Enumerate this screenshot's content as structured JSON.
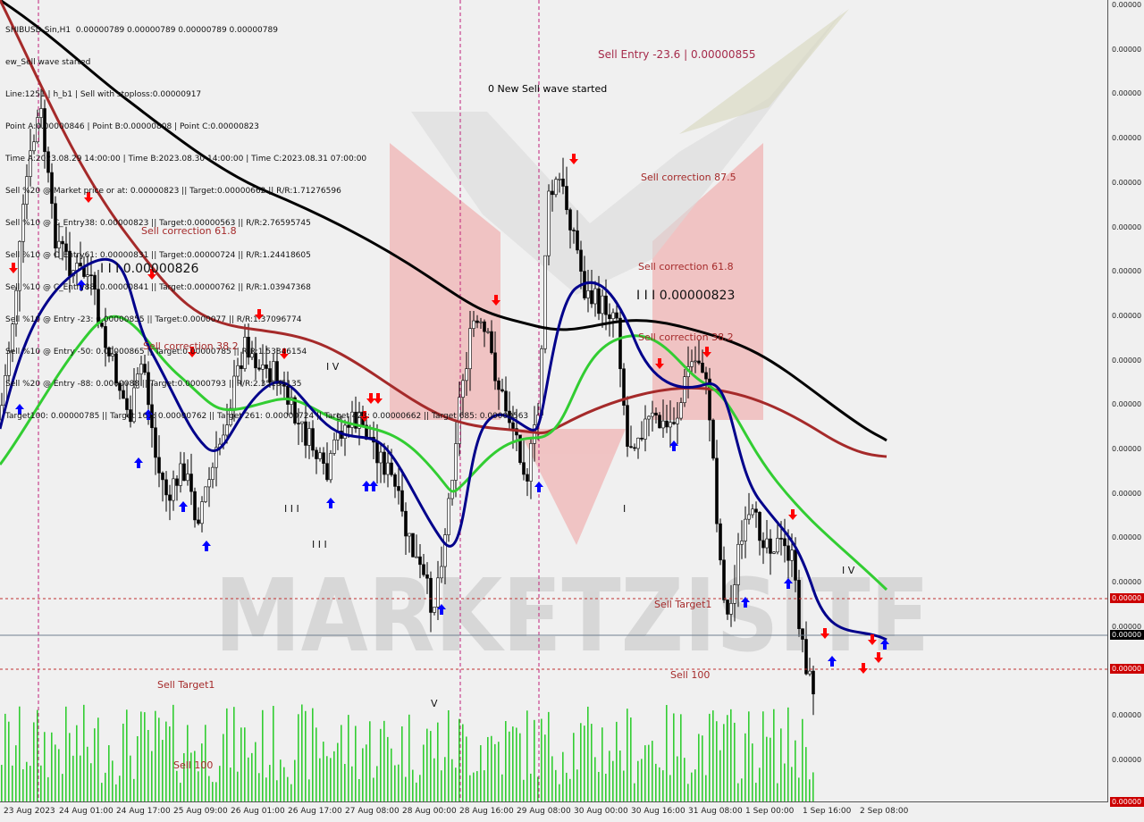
{
  "header": {
    "symbol_line": "SHIBUSD-Sin,H1  0.00000789 0.00000789 0.00000789 0.00000789",
    "lines": [
      "ew_Sell wave started",
      "Line:1251 | h_b1 | Sell with stoploss:0.00000917",
      "Point A:0.00000846 | Point B:0.00000808 | Point C:0.00000823",
      "Time A:2023.08.29 14:00:00 | Time B:2023.08.30 14:00:00 | Time C:2023.08.31 07:00:00",
      "Sell %20 @ Market price or at: 0.00000823 || Target:0.00000662 || R/R:1.71276596",
      "Sell %10 @ C_Entry38: 0.00000823 || Target:0.00000563 || R/R:2.76595745",
      "Sell %10 @ C_Entry61: 0.00000831 || Target:0.00000724 || R/R:1.24418605",
      "Sell %10 @ C_Entry88: 0.00000841 || Target:0.00000762 || R/R:1.03947368",
      "Sell %10 @ Entry -23: 0.00000855 || Target:0.0000077 || R/R:1.37096774",
      "Sell %10 @ Entry -50: 0.00000865 || Target:0.00000785 || R/R:1.53846154",
      "Sell %20 @ Entry -88: 0.0000088 || Target:0.00000793 || R/R:2.35135135",
      "Target100: 0.00000785 || Target 161: 0.00000762 || Target 261: 0.00000724 || Target 423: 0.00000662 || Target 685: 0.00000563"
    ]
  },
  "annotations": {
    "sell_entry": "Sell Entry -23.6 | 0.00000855",
    "new_wave": "0 New Sell wave started",
    "sell_corr_875": "Sell correction 87.5",
    "sell_corr_618_left": "Sell correction 61.8",
    "sell_corr_618_right": "Sell correction 61.8",
    "sell_corr_382_left": "Sell correction 38.2",
    "sell_corr_382_right": "Sell correction 38.2",
    "level_left": "I I I 0.00000826",
    "level_right": "I I I 0.00000823",
    "sell_target1_right": "Sell Target1",
    "sell_100_right": "Sell 100",
    "sell_target1_left": "Sell Target1",
    "sell_100_left": "Sell 100",
    "wave_iv_1": "I V",
    "wave_iii_1": "I I I",
    "wave_iii_2": "I I I",
    "wave_v": "V",
    "wave_iv_2": "I V",
    "wave_i": "I",
    "watermark": "MARKETZISITE"
  },
  "y_axis": {
    "ticks": [
      "0.00000",
      "0.00000",
      "0.00000",
      "0.00000",
      "0.00000",
      "0.00000",
      "0.00000",
      "0.00000",
      "0.00000",
      "0.00000",
      "0.00000",
      "0.00000",
      "0.00000",
      "0.00000",
      "0.00000",
      "0.00000",
      "0.00000",
      "0.00000"
    ],
    "tags": {
      "red_top": "0.00000",
      "current": "0.00000",
      "red_bottom": "0.00000",
      "bottom": "0.00000"
    }
  },
  "x_axis": {
    "ticks": [
      "23 Aug 2023",
      "24 Aug 01:00",
      "24 Aug 17:00",
      "25 Aug 09:00",
      "26 Aug 01:00",
      "26 Aug 17:00",
      "27 Aug 08:00",
      "28 Aug 00:00",
      "28 Aug 16:00",
      "29 Aug 08:00",
      "30 Aug 00:00",
      "30 Aug 16:00",
      "31 Aug 08:00",
      "1 Sep 00:00",
      "1 Sep 16:00",
      "2 Sep 08:00"
    ]
  },
  "colors": {
    "background": "#f0f0f0",
    "ma_black": "#000000",
    "ma_darkred": "#a52a2a",
    "ma_navy": "#00008b",
    "ma_green": "#32cd32",
    "volume": "#32cd32",
    "sell_arrow": "#ff0000",
    "buy_arrow": "#0000ff",
    "label_red": "#a52a2a",
    "current_tag": "#000000",
    "target_tag": "#cc0000"
  },
  "chart_data": {
    "type": "candlestick",
    "symbol": "SHIBUSD-Sin",
    "timeframe": "H1",
    "levels": {
      "stoploss": 9.17e-06,
      "point_a": 8.46e-06,
      "point_b": 8.08e-06,
      "point_c": 8.23e-06,
      "target_100": 7.85e-06,
      "target_161": 7.62e-06,
      "target_261": 7.24e-06,
      "target_423": 6.62e-06,
      "target_685": 5.63e-06
    },
    "closes": [
      8.26e-06,
      8.3e-06,
      8.22e-06,
      8.12e-06,
      8.15e-06,
      8.06e-06,
      8e-06,
      7.98e-06,
      8.02e-06,
      7.96e-06,
      8.01e-06,
      8.08e-06,
      8.12e-06,
      8.06e-06,
      8e-06,
      7.98e-06,
      7.94e-06,
      8e-06,
      8.03e-06,
      7.97e-06,
      7.9e-06,
      7.85e-06,
      7.83e-06,
      7.9e-06,
      8.06e-06,
      8.16e-06,
      8.12e-06,
      8e-06,
      7.96e-06,
      8.08e-06,
      8.4e-06,
      8.32e-06,
      8.2e-06,
      8.12e-06,
      8.15e-06,
      8.1e-06,
      8.02e-06,
      8.08e-06,
      8.12e-06,
      8.06e-06,
      8.1e-06,
      8.15e-06,
      8.2e-06,
      8.12e-06,
      8.06e-06,
      8e-06,
      7.85e-06,
      7.78e-06,
      7.86e-06,
      7.8e-06,
      7.83e-06,
      7.89e-06
    ]
  }
}
